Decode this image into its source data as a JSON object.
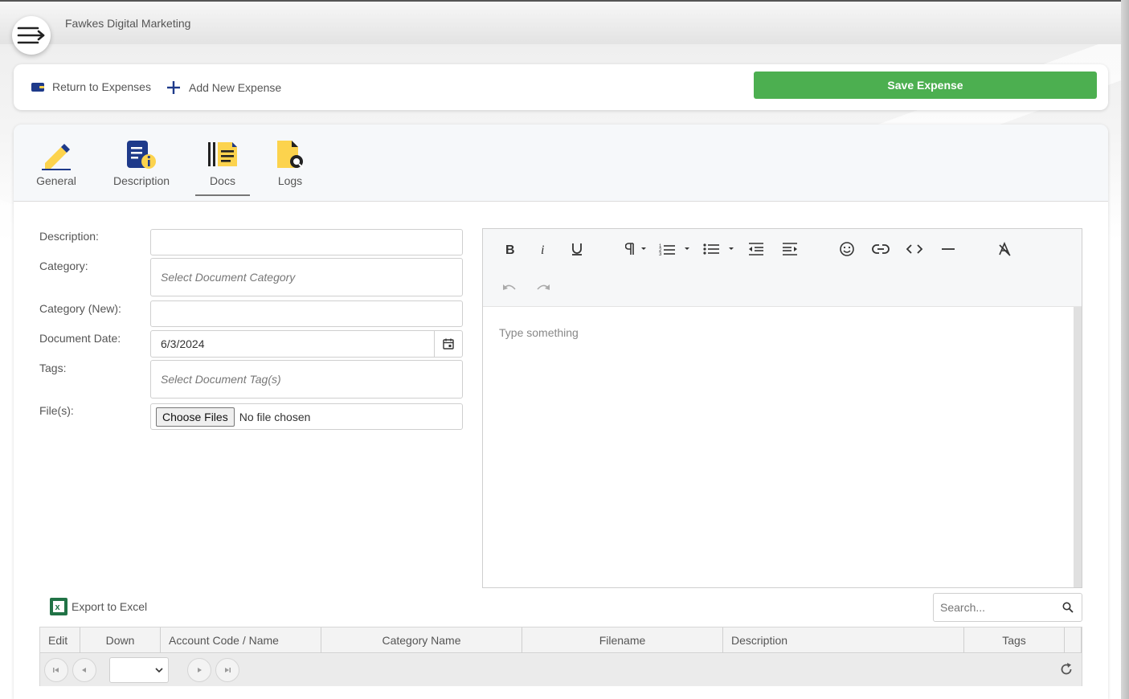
{
  "app": {
    "company_name": "Fawkes Digital Marketing"
  },
  "actions": {
    "return_label": "Return to Expenses",
    "add_label": "Add New Expense",
    "save_label": "Save Expense"
  },
  "tabs": [
    {
      "label": "General",
      "icon": "pencil-icon"
    },
    {
      "label": "Description",
      "icon": "document-info-icon"
    },
    {
      "label": "Docs",
      "icon": "docs-list-icon",
      "active": true
    },
    {
      "label": "Logs",
      "icon": "file-search-icon"
    }
  ],
  "form": {
    "description_label": "Description:",
    "description_value": "",
    "category_label": "Category:",
    "category_placeholder": "Select Document Category",
    "category_new_label": "Category (New):",
    "category_new_value": "",
    "date_label": "Document Date:",
    "date_value": "6/3/2024",
    "tags_label": "Tags:",
    "tags_placeholder": "Select Document Tag(s)",
    "files_label": "File(s):",
    "choose_files_label": "Choose Files",
    "no_file_text": "No file chosen"
  },
  "editor": {
    "placeholder": "Type something",
    "tools": [
      "bold",
      "italic",
      "underline",
      "paragraph",
      "ordered-list",
      "unordered-list",
      "outdent",
      "indent",
      "emoji",
      "link",
      "code",
      "horizontal-rule",
      "clear-format",
      "undo",
      "redo"
    ]
  },
  "grid": {
    "export_label": "Export to Excel",
    "search_placeholder": "Search...",
    "columns": [
      "Edit",
      "Down",
      "Account Code / Name",
      "Category Name",
      "Filename",
      "Description",
      "Tags"
    ]
  },
  "colors": {
    "save_button": "#4caf50",
    "icon_blue": "#1e3a8a",
    "icon_yellow": "#fcd34d",
    "excel_green": "#217346"
  }
}
